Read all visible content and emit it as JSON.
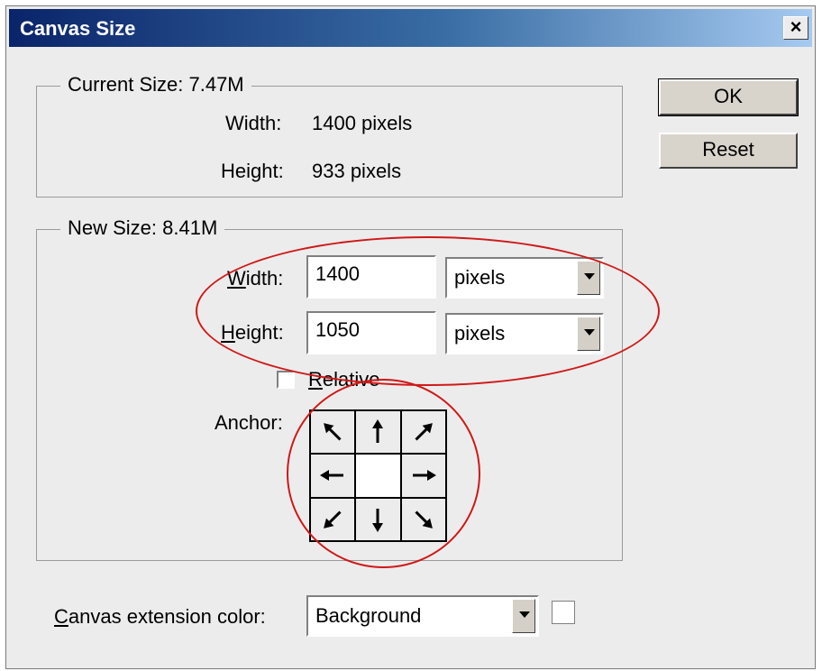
{
  "window": {
    "title": "Canvas Size",
    "close_glyph": "×"
  },
  "current_size": {
    "legend": "Current Size: 7.47M",
    "width_label": "Width:",
    "width_value": "1400 pixels",
    "height_label": "Height:",
    "height_value": "933 pixels"
  },
  "new_size": {
    "legend": "New Size: 8.41M",
    "width_label_first": "W",
    "width_label_rest": "idth:",
    "width_value": "1400",
    "width_unit": "pixels",
    "height_label_first": "H",
    "height_label_rest": "eight:",
    "height_value": "1050",
    "height_unit": "pixels",
    "relative_first": "R",
    "relative_rest": "elative",
    "relative_checked": false,
    "anchor_label": "Anchor:"
  },
  "buttons": {
    "ok": "OK",
    "reset": "Reset"
  },
  "extension": {
    "label_first": "C",
    "label_rest": "anvas extension color:",
    "value": "Background",
    "swatch_color": "#ffffff"
  },
  "annotation_color": "#d01818"
}
